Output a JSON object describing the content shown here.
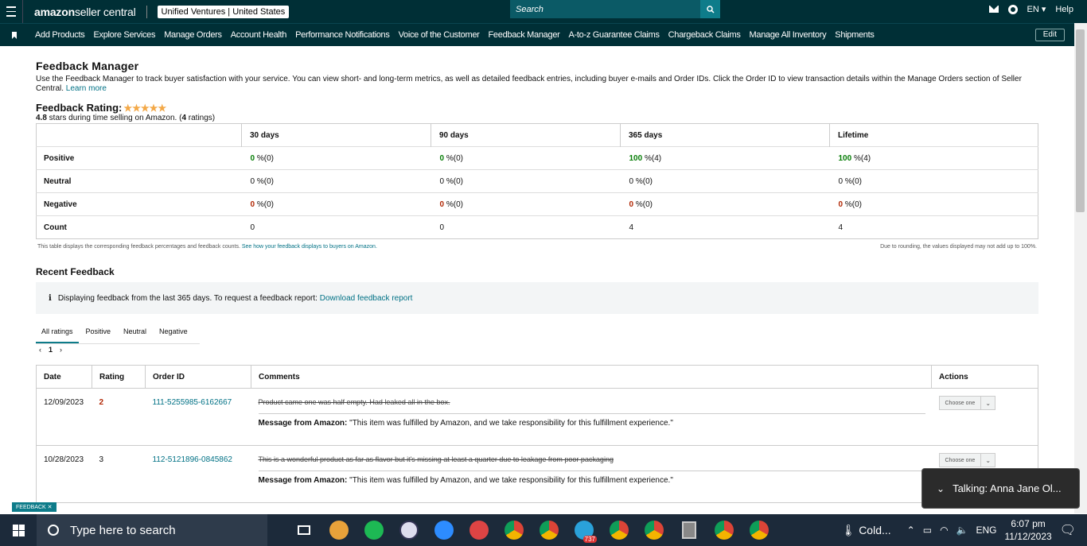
{
  "topbar": {
    "brand_amazon": "amazon",
    "brand_rest": " seller central",
    "account": "Unified Ventures | United States",
    "search_placeholder": "Search",
    "language": "EN",
    "help": "Help"
  },
  "nav": {
    "items": [
      "Add Products",
      "Explore Services",
      "Manage Orders",
      "Account Health",
      "Performance Notifications",
      "Voice of the Customer",
      "Feedback Manager",
      "A-to-z Guarantee Claims",
      "Chargeback Claims",
      "Manage All Inventory",
      "Shipments"
    ],
    "edit": "Edit"
  },
  "page": {
    "title": "Feedback Manager",
    "description": "Use the Feedback Manager to track buyer satisfaction with your service. You can view short- and long-term metrics, as well as detailed feedback entries, including buyer e-mails and Order IDs. Click the Order ID to view transaction details within the Manage Orders section of Seller Central.",
    "learn_more": "Learn more",
    "rating_label": "Feedback Rating:",
    "stars": "★★★★★",
    "rating_value": "4.8",
    "rating_text_mid": " stars during time selling on Amazon. (",
    "rating_count": "4",
    "rating_text_end": " ratings)"
  },
  "metrics": {
    "columns": [
      "30 days",
      "90 days",
      "365 days",
      "Lifetime"
    ],
    "rows": [
      {
        "label": "Positive",
        "cells": [
          {
            "v": "0",
            "s": " %(0)"
          },
          {
            "v": "0",
            "s": " %(0)"
          },
          {
            "v": "100",
            "s": " %(4)"
          },
          {
            "v": "100",
            "s": " %(4)"
          }
        ]
      },
      {
        "label": "Neutral",
        "cells": [
          {
            "v": "0",
            "s": " %(0)"
          },
          {
            "v": "0",
            "s": " %(0)"
          },
          {
            "v": "0",
            "s": " %(0)"
          },
          {
            "v": "0",
            "s": " %(0)"
          }
        ]
      },
      {
        "label": "Negative",
        "cells": [
          {
            "v": "0",
            "s": " %(0)"
          },
          {
            "v": "0",
            "s": " %(0)"
          },
          {
            "v": "0",
            "s": " %(0)"
          },
          {
            "v": "0",
            "s": " %(0)"
          }
        ]
      },
      {
        "label": "Count",
        "cells": [
          {
            "v": "0",
            "s": ""
          },
          {
            "v": "0",
            "s": ""
          },
          {
            "v": "4",
            "s": ""
          },
          {
            "v": "4",
            "s": ""
          }
        ]
      }
    ],
    "note_left": "This table displays the corresponding feedback percentages and feedback counts.",
    "note_link": "See how your feedback displays to buyers on Amazon.",
    "note_right": "Due to rounding, the values displayed may not add up to 100%."
  },
  "recent": {
    "title": "Recent Feedback",
    "info_icon": "i",
    "info_text": "Displaying feedback from the last 365 days. To request a feedback report:",
    "info_link": "Download feedback report",
    "tabs": [
      "All ratings",
      "Positive",
      "Neutral",
      "Negative"
    ],
    "page": "1",
    "prev": "‹",
    "next": "›",
    "columns": {
      "date": "Date",
      "rating": "Rating",
      "order": "Order ID",
      "comments": "Comments",
      "actions": "Actions"
    },
    "rows": [
      {
        "date": "12/09/2023",
        "rating": "2",
        "order": "111-5255985-6162667",
        "comment": "Product came one was half empty. Had leaked all in the box.",
        "msg_label": "Message from Amazon:",
        "msg": " \"This item was fulfilled by Amazon, and we take responsibility for this fulfillment experience.\"",
        "action": "Choose one"
      },
      {
        "date": "10/28/2023",
        "rating": "3",
        "order": "112-5121896-0845862",
        "comment": "This is a wonderful product as far as flavor but it's missing at least a quarter due to leakage from poor packaging",
        "msg_label": "Message from Amazon:",
        "msg": " \"This item was fulfilled by Amazon, and we take responsibility for this fulfillment experience.\"",
        "action": "Choose one"
      }
    ]
  },
  "overlay": {
    "feedback_tab": "FEEDBACK ✕",
    "talking": "Talking: Anna Jane Ol..."
  },
  "taskbar": {
    "search": "Type here to search",
    "weather": "Cold...",
    "lang": "ENG",
    "time": "6:07 pm",
    "date": "11/12/2023",
    "telegram_badge": "737"
  }
}
